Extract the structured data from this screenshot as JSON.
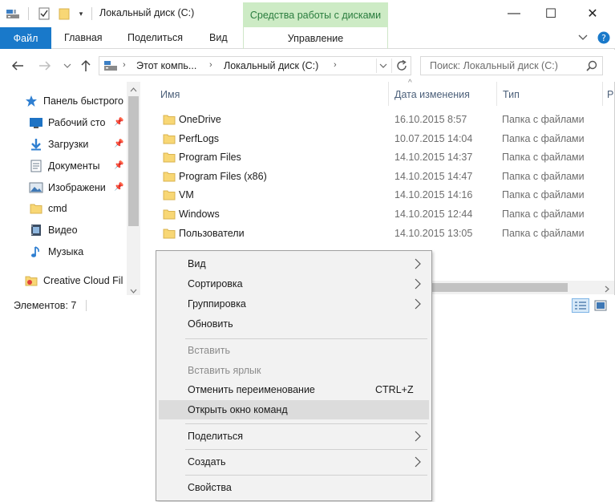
{
  "window": {
    "title": "Локальный диск (C:)",
    "context_tab_group": "Средства работы с дисками",
    "minimize_glyph": "—",
    "maximize_glyph": "☐",
    "close_glyph": "✕"
  },
  "ribbon": {
    "tabs": [
      {
        "label": "Файл",
        "active": true
      },
      {
        "label": "Главная"
      },
      {
        "label": "Поделиться"
      },
      {
        "label": "Вид"
      },
      {
        "label": "Управление"
      }
    ],
    "accent_color": "#1979ca",
    "context_color": "#cdebc5"
  },
  "address": {
    "breadcrumbs": [
      "Этот компь...",
      "Локальный диск (C:)"
    ],
    "search_placeholder": "Поиск: Локальный диск (C:)"
  },
  "nav_pane": {
    "items": [
      {
        "label": "Панель быстрого",
        "icon": "star-icon",
        "pinned": false
      },
      {
        "label": "Рабочий сто",
        "icon": "desktop-icon",
        "pinned": true
      },
      {
        "label": "Загрузки",
        "icon": "download-icon",
        "pinned": true
      },
      {
        "label": "Документы",
        "icon": "documents-icon",
        "pinned": true
      },
      {
        "label": "Изображени",
        "icon": "pictures-icon",
        "pinned": true
      },
      {
        "label": "cmd",
        "icon": "folder-icon",
        "pinned": false
      },
      {
        "label": "Видео",
        "icon": "video-icon",
        "pinned": false
      },
      {
        "label": "Музыка",
        "icon": "music-icon",
        "pinned": false
      },
      {
        "label": "Creative Cloud Fil",
        "icon": "creative-cloud-icon",
        "pinned": false
      }
    ]
  },
  "file_list": {
    "columns": [
      "Имя",
      "Дата изменения",
      "Тип",
      "Р"
    ],
    "rows": [
      {
        "name": "OneDrive",
        "date": "16.10.2015 8:57",
        "type": "Папка с файлами"
      },
      {
        "name": "PerfLogs",
        "date": "10.07.2015 14:04",
        "type": "Папка с файлами"
      },
      {
        "name": "Program Files",
        "date": "14.10.2015 14:37",
        "type": "Папка с файлами"
      },
      {
        "name": "Program Files (x86)",
        "date": "14.10.2015 14:47",
        "type": "Папка с файлами"
      },
      {
        "name": "VM",
        "date": "14.10.2015 14:16",
        "type": "Папка с файлами"
      },
      {
        "name": "Windows",
        "date": "14.10.2015 12:44",
        "type": "Папка с файлами"
      },
      {
        "name": "Пользователи",
        "date": "14.10.2015 13:05",
        "type": "Папка с файлами"
      }
    ]
  },
  "status": {
    "items_count": "Элементов: 7"
  },
  "context_menu": {
    "items": [
      {
        "label": "Вид",
        "submenu": true
      },
      {
        "label": "Сортировка",
        "submenu": true
      },
      {
        "label": "Группировка",
        "submenu": true
      },
      {
        "label": "Обновить"
      },
      {
        "label": "Вставить",
        "disabled": true
      },
      {
        "label": "Вставить ярлык",
        "disabled": true
      },
      {
        "label": "Отменить переименование",
        "shortcut": "CTRL+Z"
      },
      {
        "label": "Открыть окно команд",
        "highlighted": true
      },
      {
        "label": "Поделиться",
        "submenu": true
      },
      {
        "label": "Создать",
        "submenu": true
      },
      {
        "label": "Свойства"
      }
    ]
  }
}
